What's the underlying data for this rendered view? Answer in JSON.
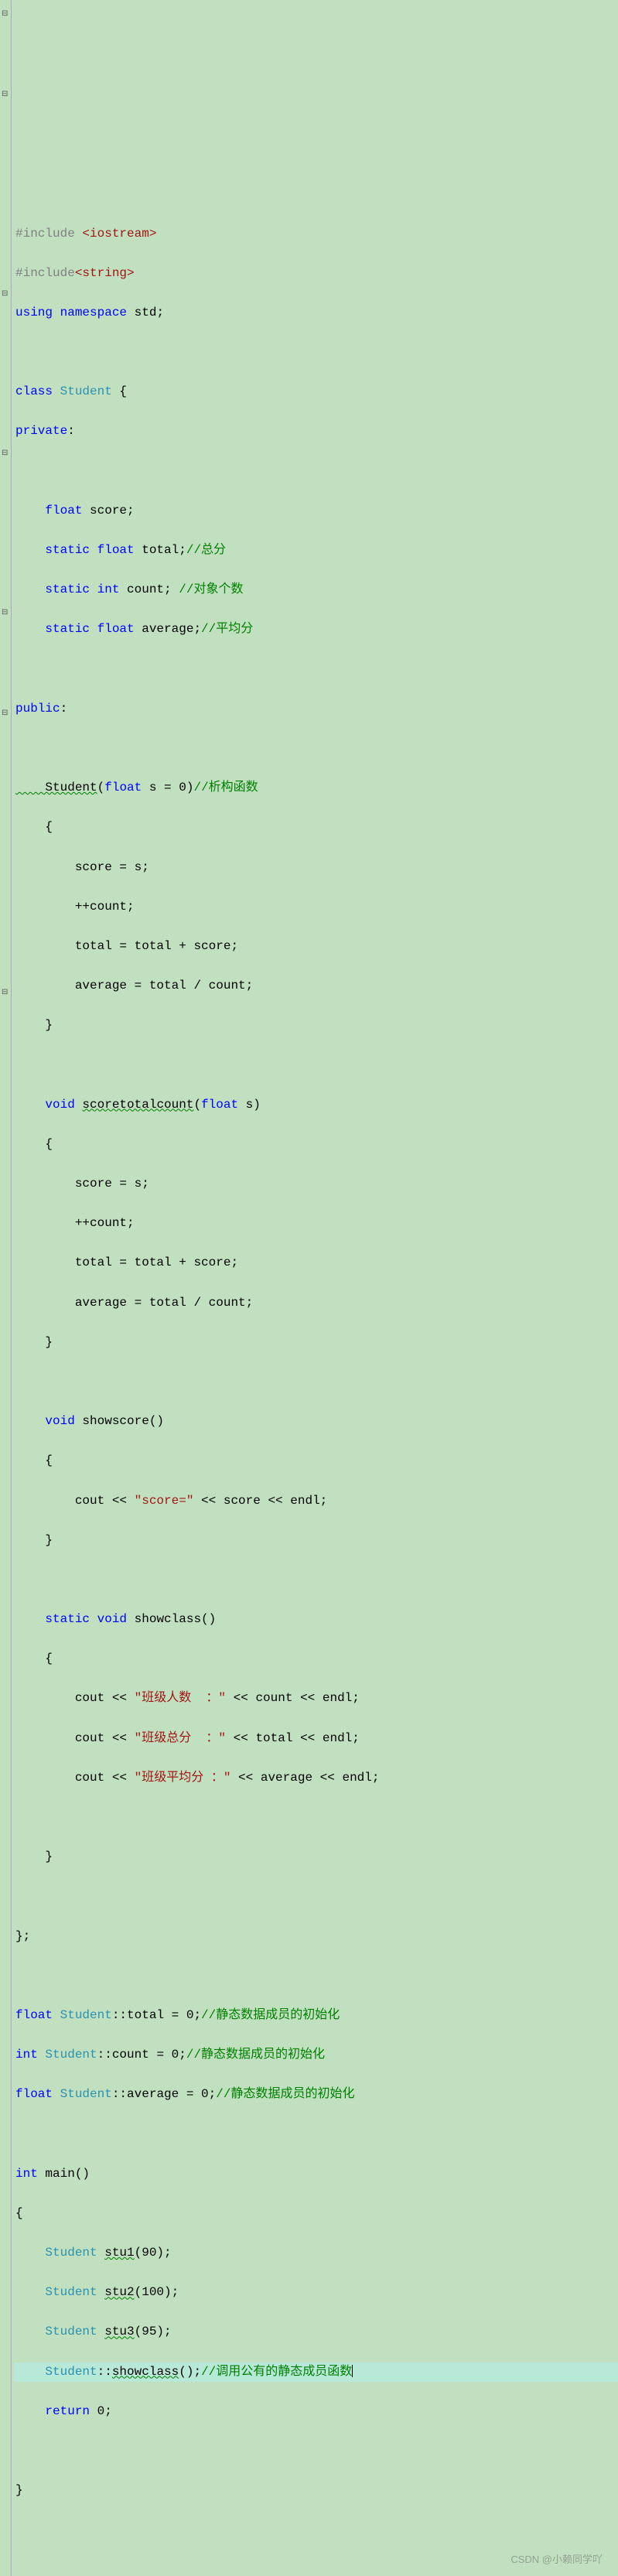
{
  "code": {
    "l1a": "#include ",
    "l1b": "<iostream>",
    "l2a": "#include",
    "l2b": "<string>",
    "l3a": "using",
    "l3b": " namespace ",
    "l3c": "std;",
    "l5a": "class ",
    "l5b": "Student",
    "l5c": " {",
    "l6a": "private",
    "l6b": ":",
    "l8a": "    float",
    "l8b": " score;",
    "l9a": "    static float",
    "l9b": " total;",
    "l9c": "//总分",
    "l10a": "    static int",
    "l10b": " count; ",
    "l10c": "//对象个数",
    "l11a": "    static float",
    "l11b": " average;",
    "l11c": "//平均分",
    "l13a": "public",
    "l13b": ":",
    "l15a": "    Student",
    "l15b": "(",
    "l15c": "float",
    "l15d": " s = 0)",
    "l15e": "//析构函数",
    "l16": "    {",
    "l17": "        score = s;",
    "l18": "        ++count;",
    "l19": "        total = total + score;",
    "l20": "        average = total / count;",
    "l21": "    }",
    "l23a": "    void ",
    "l23b": "scoretotalcount",
    "l23c": "(",
    "l23d": "float",
    "l23e": " s)",
    "l24": "    {",
    "l25": "        score = s;",
    "l26": "        ++count;",
    "l27": "        total = total + score;",
    "l28": "        average = total / count;",
    "l29": "    }",
    "l31a": "    void",
    "l31b": " showscore()",
    "l32": "    {",
    "l33a": "        cout << ",
    "l33b": "\"score=\"",
    "l33c": " << score << endl;",
    "l34": "    }",
    "l36a": "    static void",
    "l36b": " showclass()",
    "l37": "    {",
    "l38a": "        cout << ",
    "l38b": "\"班级人数  ：\"",
    "l38c": " << count << endl;",
    "l39a": "        cout << ",
    "l39b": "\"班级总分  ：\"",
    "l39c": " << total << endl;",
    "l40a": "        cout << ",
    "l40b": "\"班级平均分 ：\"",
    "l40c": " << average << endl;",
    "l42": "    }",
    "l44": "};",
    "l46a": "float ",
    "l46b": "Student",
    "l46c": "::total = 0;",
    "l46d": "//静态数据成员的初始化",
    "l47a": "int ",
    "l47b": "Student",
    "l47c": "::count = 0;",
    "l47d": "//静态数据成员的初始化",
    "l48a": "float ",
    "l48b": "Student",
    "l48c": "::average = 0;",
    "l48d": "//静态数据成员的初始化",
    "l50a": "int",
    "l50b": " main()",
    "l51": "{",
    "l52a": "    Student ",
    "l52b": "stu1",
    "l52c": "(90);",
    "l53a": "    Student ",
    "l53b": "stu2",
    "l53c": "(100);",
    "l54a": "    Student ",
    "l54b": "stu3",
    "l54c": "(95);",
    "l55a": "    Student",
    "l55b": "::",
    "l55c": "showclass",
    "l55d": "();",
    "l55e": "//调用公有的静态成员函数",
    "l56a": "    return",
    "l56b": " 0;",
    "l58": "}"
  },
  "watermark": "CSDN @小赖同学吖",
  "fold": {
    "minus": "⊟",
    "plus": "⊞"
  }
}
